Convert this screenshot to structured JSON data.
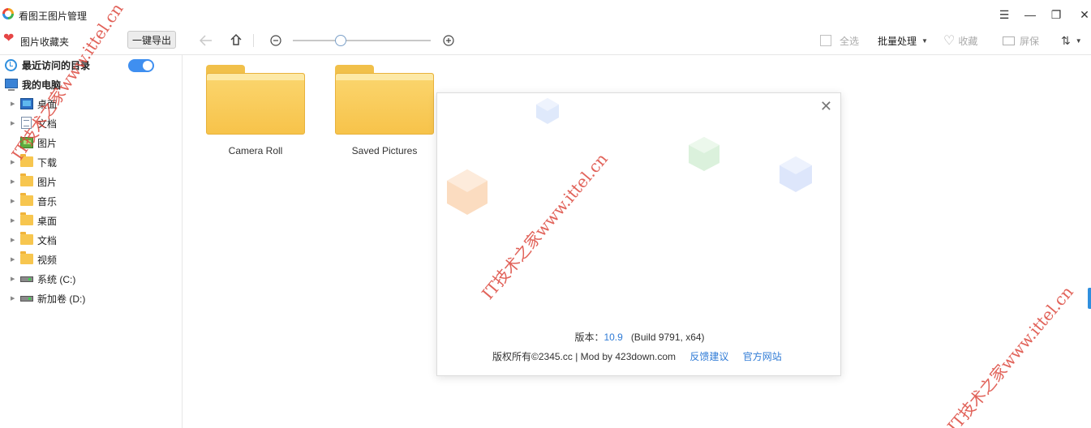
{
  "window": {
    "title": "看图王图片管理",
    "controls": {
      "menu": "☰",
      "minimize": "—",
      "restore": "❐",
      "close": "✕"
    }
  },
  "toolbar": {
    "favorites_label": "图片收藏夹",
    "export_label": "一键导出",
    "select_all_label": "全选",
    "batch_label": "批量处理",
    "favorite_label": "收藏",
    "screen_label": "屏保",
    "sort_label": "⇅"
  },
  "sidebar": {
    "recent_label": "最近访问的目录",
    "recent_toggle_on": true,
    "computer_label": "我的电脑",
    "items": [
      {
        "label": "桌面",
        "icon": "desktop-icon"
      },
      {
        "label": "文档",
        "icon": "document-icon"
      },
      {
        "label": "图片",
        "icon": "picture-icon"
      },
      {
        "label": "下载",
        "icon": "folder-icon"
      },
      {
        "label": "图片",
        "icon": "folder-icon"
      },
      {
        "label": "音乐",
        "icon": "folder-icon"
      },
      {
        "label": "桌面",
        "icon": "folder-icon"
      },
      {
        "label": "文档",
        "icon": "folder-icon"
      },
      {
        "label": "视频",
        "icon": "folder-icon"
      },
      {
        "label": "系统 (C:)",
        "icon": "drive-icon"
      },
      {
        "label": "新加卷 (D:)",
        "icon": "drive-icon"
      }
    ]
  },
  "content": {
    "folders": [
      {
        "name": "Camera Roll"
      },
      {
        "name": "Saved Pictures"
      }
    ]
  },
  "about": {
    "version_prefix": "版本：",
    "version_number": "10.9",
    "build": "   (Build 9791, x64)",
    "copyright": "版权所有©2345.cc | Mod by 423down.com",
    "feedback_link": "反馈建议",
    "website_link": "官方网站"
  },
  "watermark": {
    "text": "IT技术之家www.ittel.cn",
    "color": "#dc463c"
  }
}
